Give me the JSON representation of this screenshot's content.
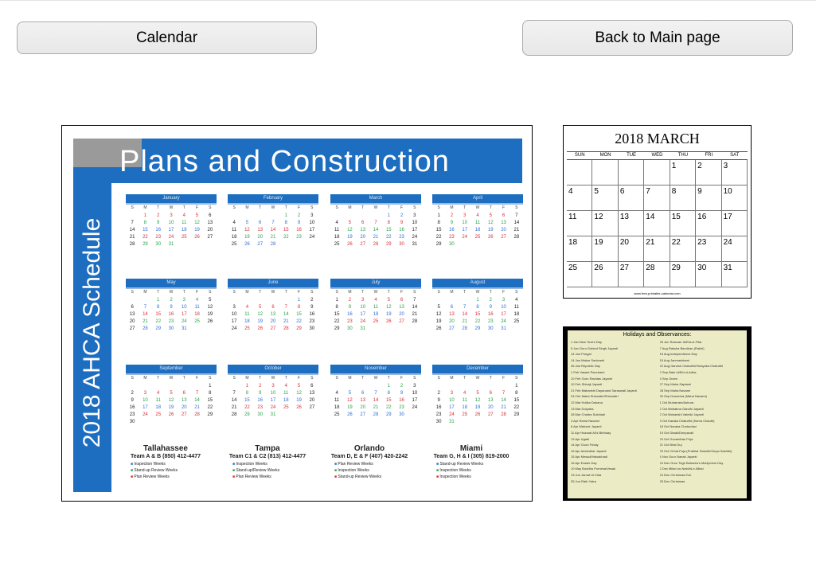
{
  "buttons": {
    "calendar": "Calendar",
    "back": "Back to Main page"
  },
  "main_calendar": {
    "title": "Plans and Construction",
    "vertical_title": "2018 AHCA Schedule",
    "dow": [
      "S",
      "M",
      "T",
      "W",
      "T",
      "F",
      "S"
    ],
    "months": [
      {
        "name": "January",
        "lead": 1,
        "days": 31
      },
      {
        "name": "February",
        "lead": 4,
        "days": 28
      },
      {
        "name": "March",
        "lead": 4,
        "days": 31
      },
      {
        "name": "April",
        "lead": 0,
        "days": 30
      },
      {
        "name": "May",
        "lead": 2,
        "days": 31
      },
      {
        "name": "June",
        "lead": 5,
        "days": 30
      },
      {
        "name": "July",
        "lead": 0,
        "days": 31
      },
      {
        "name": "August",
        "lead": 3,
        "days": 31
      },
      {
        "name": "September",
        "lead": 6,
        "days": 30
      },
      {
        "name": "October",
        "lead": 1,
        "days": 31
      },
      {
        "name": "November",
        "lead": 4,
        "days": 30
      },
      {
        "name": "December",
        "lead": 6,
        "days": 31
      }
    ],
    "offices": [
      {
        "city": "Tallahassee",
        "team": "Team A & B",
        "phone": "(850) 412-4477",
        "lines": [
          "Inspection Weeks",
          "Stand-up Review Weeks",
          "Plan Review Weeks"
        ]
      },
      {
        "city": "Tampa",
        "team": "Team C1 & C2",
        "phone": "(813) 412-4477",
        "lines": [
          "Inspection Weeks",
          "Stand-up/Review Weeks",
          "Plan Review Weeks"
        ]
      },
      {
        "city": "Orlando",
        "team": "Team D, E & F",
        "phone": "(407) 420-2242",
        "lines": [
          "Plan Review Weeks",
          "Inspection Weeks",
          "Stand-up Review Weeks"
        ]
      },
      {
        "city": "Miami",
        "team": "Team G, H & I",
        "phone": "(305) 819-2000",
        "lines": [
          "Stand-up Review Weeks",
          "Inspection Weeks",
          "Inspection Weeks"
        ]
      }
    ],
    "colors": {
      "band": "#1d6ec0",
      "red": "#d9303a",
      "green": "#2aa34a",
      "blue": "#2d6fd6"
    }
  },
  "march": {
    "title": "2018  MARCH",
    "dow": [
      "SUN",
      "MON",
      "TUE",
      "WED",
      "THU",
      "FRI",
      "SAT"
    ],
    "lead": 4,
    "days": 31,
    "footer": "www.free-printable-calendar.com"
  },
  "holidays": {
    "title": "Holidays and Observances:",
    "left": [
      "1 Jan  New Year's Day",
      "5 Jan  Guru Gobind Singh Jayanti",
      "14 Jan  Pongal",
      "14 Jan  Makar Sankranti",
      "26 Jan  Republic Day",
      "1 Feb  Vasant Panchami",
      "10 Feb  Guru Ravidas Jayanti",
      "10 Feb  Shivaji Jayanti",
      "21 Feb  Maharishi Dayanand Saraswati Jayanti",
      "24 Feb  Maha Shivaratri/Shivaratri",
      "12 Mar  Holika Dahana",
      "13 Mar  Dolyatra",
      "28 Mar  Chaitra Sukhladi",
      "4 Apr  Rama Navami",
      "6 Apr  Mahavir Jayanti",
      "11 Apr  Hazarat Ali's Birthday",
      "13 Apr  Ugadi",
      "14 Apr  Good Friday",
      "16 Apr  Ambedkar Jayanti",
      "15 Apr  Mesadi/Vaisakhadi",
      "16 Apr  Easter Day",
      "10 May  Buddha Purnima/Vesak",
      "13 Jun  Jamat Ul-Vida",
      "25 Jun  Rath Yatra"
    ],
    "right": [
      "26 Jun  Ramzan Id/Eid-ul-Fitar",
      "7 Aug  Raksha Bandhan (Rakhi)",
      "15 Aug  Independence Day",
      "15 Aug  Janmashtami",
      "22 Aug  Ganesh Chaturthi/Vinayaka Chaturthi",
      "2 Sep  Bakr Id/Eid ul-Adha",
      "4 Sep  Onam",
      "27 Sep  Maha Saptami",
      "28 Sep  Maha Navami",
      "30 Sep  Dussehra (Maha Navami)",
      "1 Oct  Muharram/Ashura",
      "2 Oct  Mahatma Gandhi Jayanti",
      "2 Oct  Maharishi Valmiki Jayanti",
      "9 Oct  Karaka Chaturthi (Karva Chauth)",
      "18 Oct  Naraka Chaturdasi",
      "19 Oct  Diwali/Deepavali",
      "20 Oct  Govardhan Puja",
      "21 Oct  Bhai Duj",
      "29 Oct  Chhat Puja (Pratihar Sashthi/Surya Sashthi)",
      "4 Nov  Guru Nanak Jayanti",
      "24 Nov  Guru Tegh Bahadur's Martyrdom Day",
      "2 Dec  Milad un-Nabi/Id-e-Milad",
      "24 Dec  Christmas Eve",
      "25 Dec  Christmas"
    ]
  }
}
